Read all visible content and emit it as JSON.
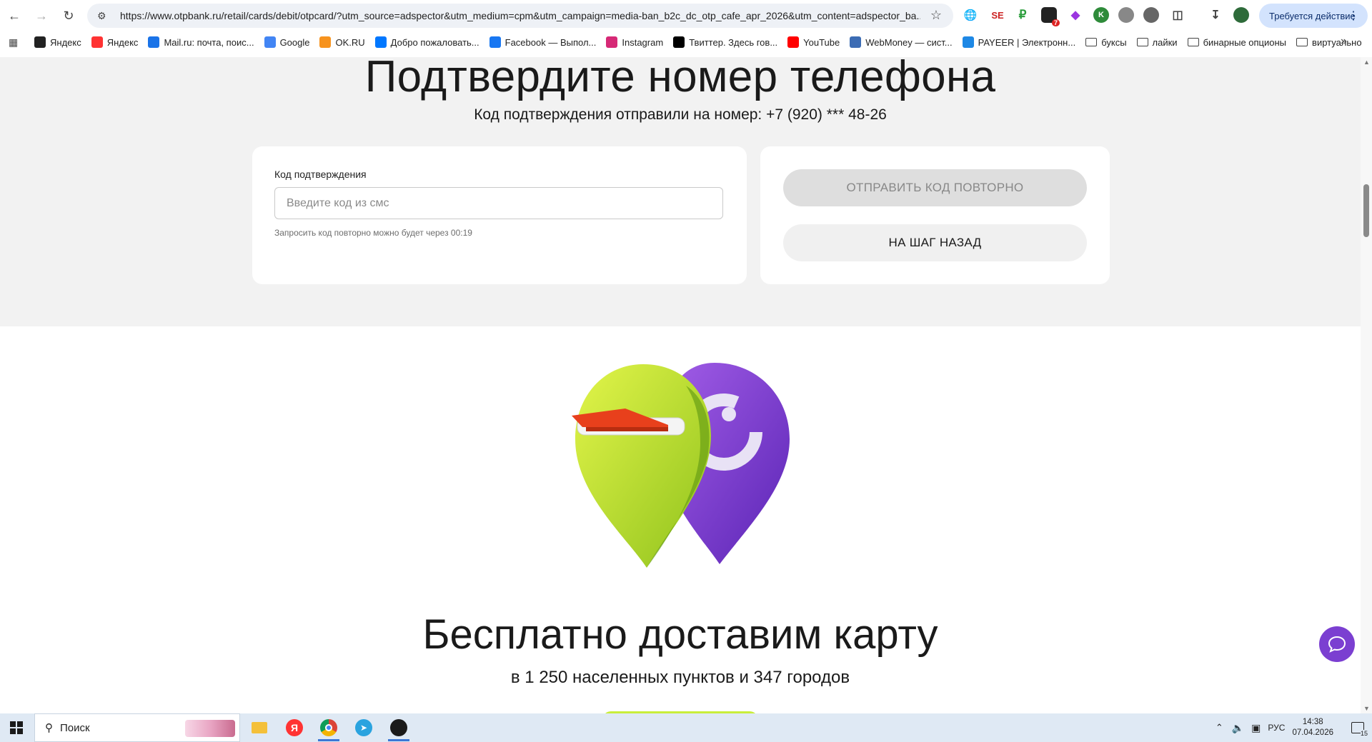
{
  "browser": {
    "url": "https://www.otpbank.ru/retail/cards/debit/otpcard/?utm_source=adspector&utm_medium=cpm&utm_campaign=media-ban_b2c_dc_otp_cafe_apr_2026&utm_content=adspector_ba...",
    "action_required": "Требуется действие",
    "extension_badge": "7"
  },
  "bookmarks": [
    {
      "label": "Яндекс",
      "color": "#222222",
      "icon": "yandex-plus-icon"
    },
    {
      "label": "Яндекс",
      "color": "#f33",
      "icon": "yandex-icon"
    },
    {
      "label": "Mail.ru: почта, поис...",
      "color": "#1a73e8",
      "icon": "mail-icon"
    },
    {
      "label": "Google",
      "color": "#4285f4",
      "icon": "google-icon"
    },
    {
      "label": "OK.RU",
      "color": "#f7931e",
      "icon": "ok-icon"
    },
    {
      "label": "Добро пожаловать...",
      "color": "#0077ff",
      "icon": "vk-icon"
    },
    {
      "label": "Facebook — Выпол...",
      "color": "#1877f2",
      "icon": "facebook-icon"
    },
    {
      "label": "Instagram",
      "color": "#d62976",
      "icon": "instagram-icon"
    },
    {
      "label": "Твиттер. Здесь гов...",
      "color": "#000000",
      "icon": "x-icon"
    },
    {
      "label": "YouTube",
      "color": "#ff0000",
      "icon": "youtube-icon"
    },
    {
      "label": "WebMoney — сист...",
      "color": "#3c6cb4",
      "icon": "webmoney-icon"
    },
    {
      "label": "PAYEER | Электронн...",
      "color": "#1e88e5",
      "icon": "payeer-icon"
    },
    {
      "label": "буксы",
      "icon": "folder-icon"
    },
    {
      "label": "лайки",
      "icon": "folder-icon"
    },
    {
      "label": "бинарные опционы",
      "icon": "folder-icon"
    },
    {
      "label": "виртуально",
      "icon": "folder-icon"
    }
  ],
  "confirm": {
    "title": "Подтвердите номер телефона",
    "subtitle": "Код подтверждения отправили на номер: +7 (920) *** 48-26",
    "field_label": "Код подтверждения",
    "placeholder": "Введите код из смс",
    "value": "",
    "hint": "Запросить код повторно можно будет через 00:19",
    "resend_label": "ОТПРАВИТЬ КОД ПОВТОРНО",
    "back_label": "НА ШАГ НАЗАД"
  },
  "delivery": {
    "title": "Бесплатно доставим карту",
    "subtitle": "в 1 250 населенных пунктов и 347 городов"
  },
  "taskbar": {
    "search_label": "Поиск",
    "lang": "РУС",
    "time": "14:38",
    "date": "07.04.2026",
    "notifications": "15"
  },
  "colors": {
    "accent_purple": "#7b3fd1",
    "accent_green": "#c9ee3a"
  }
}
